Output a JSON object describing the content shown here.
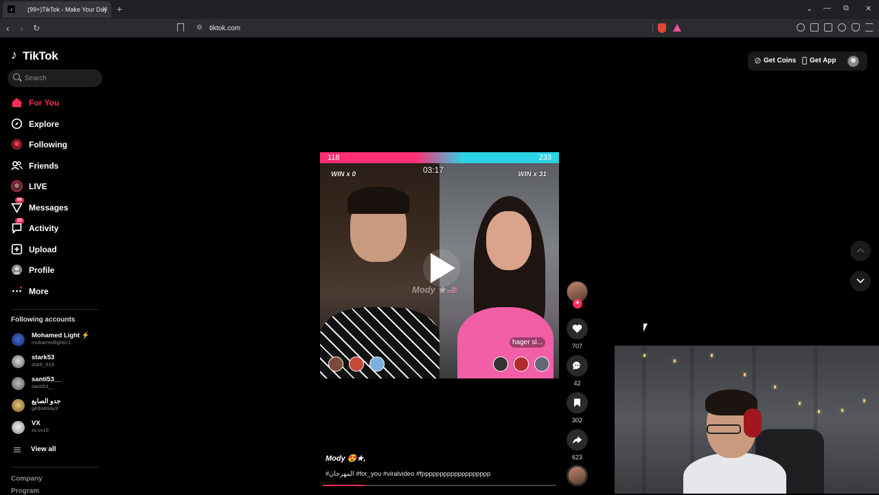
{
  "browser": {
    "tab_title": "(99+)TikTok - Make Your Day",
    "tab_close": "✕",
    "new_tab": "+",
    "url": "tiktok.com",
    "window_controls": [
      "⌄",
      "—",
      "⧉",
      "✕"
    ]
  },
  "sidebar": {
    "logo_text": "TikTok",
    "search_placeholder": "Search",
    "nav": [
      {
        "label": "For You",
        "icon": "home-icon",
        "active": true
      },
      {
        "label": "Explore",
        "icon": "compass-icon"
      },
      {
        "label": "Following",
        "icon": "following-avatar-icon"
      },
      {
        "label": "Friends",
        "icon": "friends-icon"
      },
      {
        "label": "LIVE",
        "icon": "live-avatar-icon"
      },
      {
        "label": "Messages",
        "icon": "send-icon",
        "badge": "86"
      },
      {
        "label": "Activity",
        "icon": "activity-icon",
        "badge": "23"
      },
      {
        "label": "Upload",
        "icon": "upload-icon"
      },
      {
        "label": "Profile",
        "icon": "profile-avatar-icon"
      },
      {
        "label": "More",
        "icon": "more-icon"
      }
    ],
    "following_title": "Following accounts",
    "accounts": [
      {
        "name": "Mohamed Light",
        "handle": "mohamedlightcr1",
        "live": "⚡"
      },
      {
        "name": "stark53",
        "handle": "stark_619"
      },
      {
        "name": "santi53__",
        "handle": "santi53__"
      },
      {
        "name": "جدو الصايع",
        "handle": "gedoelsay3"
      },
      {
        "name": "VX",
        "handle": "xv.vv19"
      }
    ],
    "view_all": "View all",
    "footer": [
      "Company",
      "Program"
    ]
  },
  "header": {
    "get_coins": "Get Coins",
    "get_app": "Get App"
  },
  "video": {
    "score_left": "118",
    "score_right": "233",
    "timer": "03:17",
    "win_left": "WIN x 0",
    "win_right": "WIN x 31",
    "watermark": "Mody ★🇺🇸",
    "name_tag": "hager sl...",
    "progress": 0.18
  },
  "caption": {
    "username": "Mody 😍★,",
    "tags": "#المهرجان #for_you #viralvideo #fppppppppppppppppppp"
  },
  "actions": {
    "likes": "707",
    "comments": "42",
    "saves": "302",
    "shares": "623"
  },
  "colors": {
    "accent": "#fe2c55",
    "score_left": "#ff2e73",
    "score_right": "#2cd2e6"
  }
}
